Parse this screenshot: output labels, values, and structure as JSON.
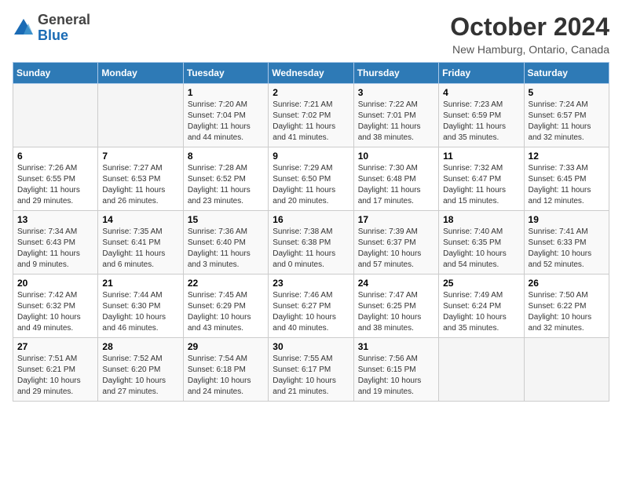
{
  "header": {
    "logo": {
      "general": "General",
      "blue": "Blue"
    },
    "title": "October 2024",
    "location": "New Hamburg, Ontario, Canada"
  },
  "weekdays": [
    "Sunday",
    "Monday",
    "Tuesday",
    "Wednesday",
    "Thursday",
    "Friday",
    "Saturday"
  ],
  "weeks": [
    [
      {
        "day": null,
        "info": null
      },
      {
        "day": null,
        "info": null
      },
      {
        "day": "1",
        "info": "Sunrise: 7:20 AM\nSunset: 7:04 PM\nDaylight: 11 hours and 44 minutes."
      },
      {
        "day": "2",
        "info": "Sunrise: 7:21 AM\nSunset: 7:02 PM\nDaylight: 11 hours and 41 minutes."
      },
      {
        "day": "3",
        "info": "Sunrise: 7:22 AM\nSunset: 7:01 PM\nDaylight: 11 hours and 38 minutes."
      },
      {
        "day": "4",
        "info": "Sunrise: 7:23 AM\nSunset: 6:59 PM\nDaylight: 11 hours and 35 minutes."
      },
      {
        "day": "5",
        "info": "Sunrise: 7:24 AM\nSunset: 6:57 PM\nDaylight: 11 hours and 32 minutes."
      }
    ],
    [
      {
        "day": "6",
        "info": "Sunrise: 7:26 AM\nSunset: 6:55 PM\nDaylight: 11 hours and 29 minutes."
      },
      {
        "day": "7",
        "info": "Sunrise: 7:27 AM\nSunset: 6:53 PM\nDaylight: 11 hours and 26 minutes."
      },
      {
        "day": "8",
        "info": "Sunrise: 7:28 AM\nSunset: 6:52 PM\nDaylight: 11 hours and 23 minutes."
      },
      {
        "day": "9",
        "info": "Sunrise: 7:29 AM\nSunset: 6:50 PM\nDaylight: 11 hours and 20 minutes."
      },
      {
        "day": "10",
        "info": "Sunrise: 7:30 AM\nSunset: 6:48 PM\nDaylight: 11 hours and 17 minutes."
      },
      {
        "day": "11",
        "info": "Sunrise: 7:32 AM\nSunset: 6:47 PM\nDaylight: 11 hours and 15 minutes."
      },
      {
        "day": "12",
        "info": "Sunrise: 7:33 AM\nSunset: 6:45 PM\nDaylight: 11 hours and 12 minutes."
      }
    ],
    [
      {
        "day": "13",
        "info": "Sunrise: 7:34 AM\nSunset: 6:43 PM\nDaylight: 11 hours and 9 minutes."
      },
      {
        "day": "14",
        "info": "Sunrise: 7:35 AM\nSunset: 6:41 PM\nDaylight: 11 hours and 6 minutes."
      },
      {
        "day": "15",
        "info": "Sunrise: 7:36 AM\nSunset: 6:40 PM\nDaylight: 11 hours and 3 minutes."
      },
      {
        "day": "16",
        "info": "Sunrise: 7:38 AM\nSunset: 6:38 PM\nDaylight: 11 hours and 0 minutes."
      },
      {
        "day": "17",
        "info": "Sunrise: 7:39 AM\nSunset: 6:37 PM\nDaylight: 10 hours and 57 minutes."
      },
      {
        "day": "18",
        "info": "Sunrise: 7:40 AM\nSunset: 6:35 PM\nDaylight: 10 hours and 54 minutes."
      },
      {
        "day": "19",
        "info": "Sunrise: 7:41 AM\nSunset: 6:33 PM\nDaylight: 10 hours and 52 minutes."
      }
    ],
    [
      {
        "day": "20",
        "info": "Sunrise: 7:42 AM\nSunset: 6:32 PM\nDaylight: 10 hours and 49 minutes."
      },
      {
        "day": "21",
        "info": "Sunrise: 7:44 AM\nSunset: 6:30 PM\nDaylight: 10 hours and 46 minutes."
      },
      {
        "day": "22",
        "info": "Sunrise: 7:45 AM\nSunset: 6:29 PM\nDaylight: 10 hours and 43 minutes."
      },
      {
        "day": "23",
        "info": "Sunrise: 7:46 AM\nSunset: 6:27 PM\nDaylight: 10 hours and 40 minutes."
      },
      {
        "day": "24",
        "info": "Sunrise: 7:47 AM\nSunset: 6:25 PM\nDaylight: 10 hours and 38 minutes."
      },
      {
        "day": "25",
        "info": "Sunrise: 7:49 AM\nSunset: 6:24 PM\nDaylight: 10 hours and 35 minutes."
      },
      {
        "day": "26",
        "info": "Sunrise: 7:50 AM\nSunset: 6:22 PM\nDaylight: 10 hours and 32 minutes."
      }
    ],
    [
      {
        "day": "27",
        "info": "Sunrise: 7:51 AM\nSunset: 6:21 PM\nDaylight: 10 hours and 29 minutes."
      },
      {
        "day": "28",
        "info": "Sunrise: 7:52 AM\nSunset: 6:20 PM\nDaylight: 10 hours and 27 minutes."
      },
      {
        "day": "29",
        "info": "Sunrise: 7:54 AM\nSunset: 6:18 PM\nDaylight: 10 hours and 24 minutes."
      },
      {
        "day": "30",
        "info": "Sunrise: 7:55 AM\nSunset: 6:17 PM\nDaylight: 10 hours and 21 minutes."
      },
      {
        "day": "31",
        "info": "Sunrise: 7:56 AM\nSunset: 6:15 PM\nDaylight: 10 hours and 19 minutes."
      },
      {
        "day": null,
        "info": null
      },
      {
        "day": null,
        "info": null
      }
    ]
  ]
}
